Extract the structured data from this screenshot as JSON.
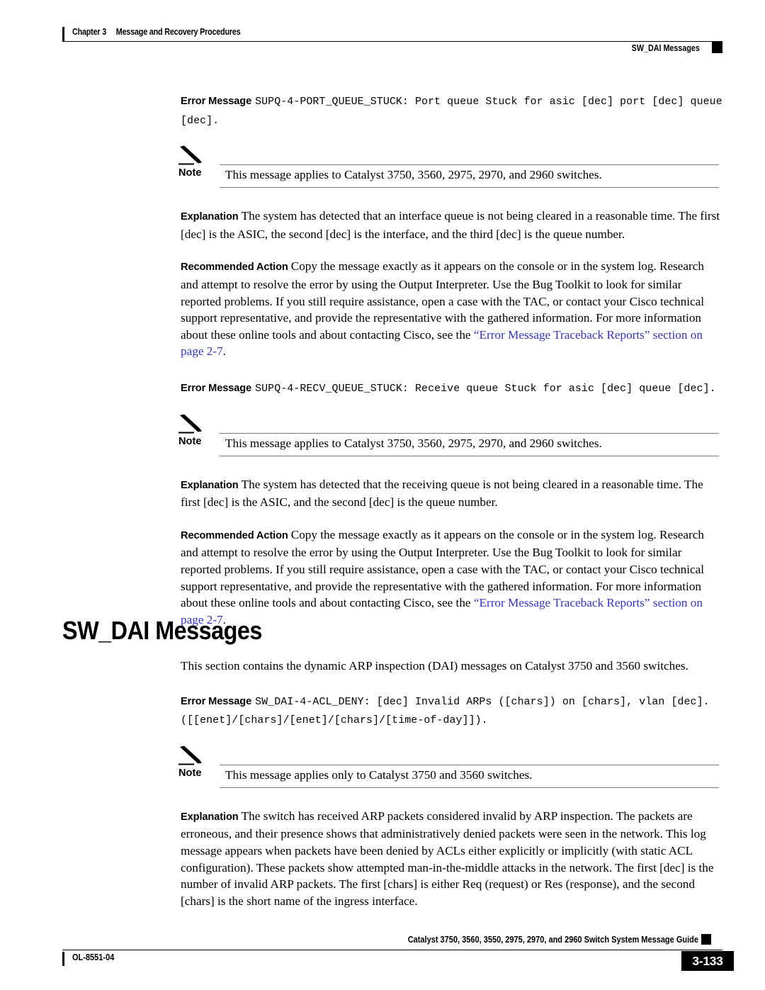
{
  "header": {
    "chapter": "Chapter 3",
    "chapter_title": "Message and Recovery Procedures",
    "running_head": "SW_DAI Messages"
  },
  "labels": {
    "error_message": "Error Message",
    "note": "Note",
    "explanation": "Explanation",
    "recommended_action": "Recommended Action"
  },
  "colors": {
    "link": "#3333cc",
    "rule": "#7a7a7a",
    "text": "#000000"
  },
  "messages": [
    {
      "id": "supq-4-port-queue-stuck",
      "syntax": "SUPQ-4-PORT_QUEUE_STUCK: Port queue Stuck for asic [dec] port [dec] queue [dec].",
      "note": "This message applies to Catalyst 3750, 3560, 2975, 2970, and 2960 switches.",
      "explanation": "The system has detected that an interface queue is not being cleared in a reasonable time. The first [dec] is the ASIC, the second [dec] is the interface, and the third [dec] is the queue number.",
      "recommended_action_text": "Copy the message exactly as it appears on the console or in the system log. Research and attempt to resolve the error by using the Output Interpreter. Use the Bug Toolkit to look for similar reported problems. If you still require assistance, open a case with the TAC, or contact your Cisco technical support representative, and provide the representative with the gathered information. For more information about these online tools and about contacting Cisco, see the ",
      "recommended_action_link": "“Error Message Traceback Reports” section on page 2-7",
      "recommended_action_tail": "."
    },
    {
      "id": "supq-4-recv-queue-stuck",
      "syntax": "SUPQ-4-RECV_QUEUE_STUCK: Receive queue Stuck for asic [dec] queue [dec].",
      "note": "This message applies to Catalyst 3750, 3560, 2975, 2970, and 2960 switches.",
      "explanation": "The system has detected that the receiving queue is not being cleared in a reasonable time. The first [dec] is the ASIC, and the second [dec] is the queue number.",
      "recommended_action_text": "Copy the message exactly as it appears on the console or in the system log. Research and attempt to resolve the error by using the Output Interpreter. Use the Bug Toolkit to look for similar reported problems. If you still require assistance, open a case with the TAC, or contact your Cisco technical support representative, and provide the representative with the gathered information. For more information about these online tools and about contacting Cisco, see the ",
      "recommended_action_link": "“Error Message Traceback Reports” section on page 2-7",
      "recommended_action_tail": "."
    }
  ],
  "section": {
    "heading": "SW_DAI Messages",
    "intro": "This section contains the dynamic ARP inspection (DAI) messages on Catalyst 3750 and 3560 switches."
  },
  "dai_message": {
    "id": "sw-dai-4-acl-deny",
    "syntax": "SW_DAI-4-ACL_DENY: [dec] Invalid ARPs ([chars]) on [chars], vlan [dec].([[enet]/[chars]/[enet]/[chars]/[time-of-day]]).",
    "note": "This message applies only to Catalyst 3750 and 3560 switches.",
    "explanation": "The switch has received ARP packets considered invalid by ARP inspection. The packets are erroneous, and their presence shows that administratively denied packets were seen in the network. This log message appears when packets have been denied by ACLs either explicitly or implicitly (with static ACL configuration). These packets show attempted man-in-the-middle attacks in the network. The first [dec] is the number of invalid ARP packets. The first [chars] is either Req (request) or Res (response), and the second [chars] is the short name of the ingress interface."
  },
  "footer": {
    "guide_title": "Catalyst 3750, 3560, 3550, 2975, 2970, and 2960 Switch System Message Guide",
    "doc_id": "OL-8551-04",
    "page_number": "3-133"
  }
}
